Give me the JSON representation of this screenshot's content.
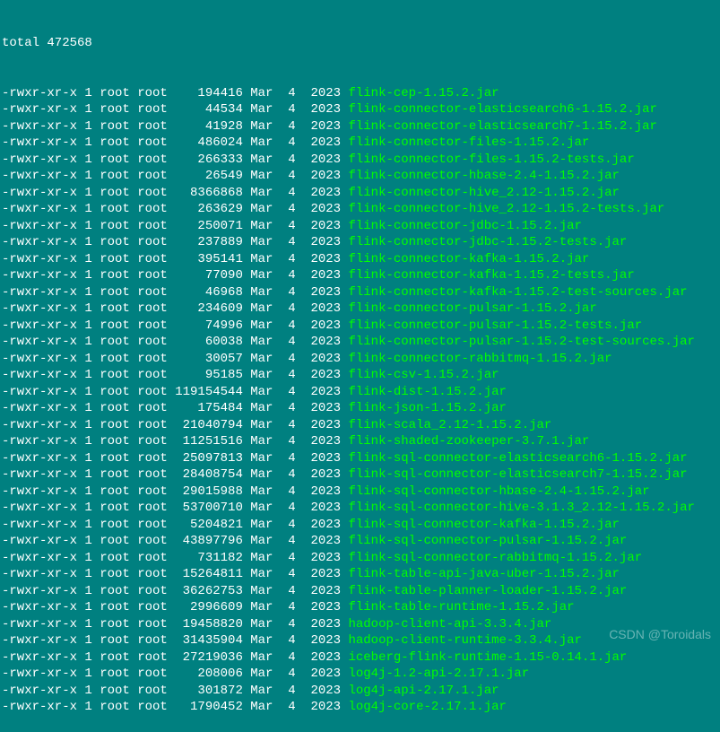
{
  "total": "total 472568",
  "watermark": "CSDN @Toroidals",
  "files": [
    {
      "perms": "-rwxr-xr-x",
      "links": "1",
      "owner": "root",
      "group": "root",
      "size": "194416",
      "month": "Mar",
      "day": "4",
      "year": "2023",
      "name": "flink-cep-1.15.2.jar"
    },
    {
      "perms": "-rwxr-xr-x",
      "links": "1",
      "owner": "root",
      "group": "root",
      "size": "44534",
      "month": "Mar",
      "day": "4",
      "year": "2023",
      "name": "flink-connector-elasticsearch6-1.15.2.jar"
    },
    {
      "perms": "-rwxr-xr-x",
      "links": "1",
      "owner": "root",
      "group": "root",
      "size": "41928",
      "month": "Mar",
      "day": "4",
      "year": "2023",
      "name": "flink-connector-elasticsearch7-1.15.2.jar"
    },
    {
      "perms": "-rwxr-xr-x",
      "links": "1",
      "owner": "root",
      "group": "root",
      "size": "486024",
      "month": "Mar",
      "day": "4",
      "year": "2023",
      "name": "flink-connector-files-1.15.2.jar"
    },
    {
      "perms": "-rwxr-xr-x",
      "links": "1",
      "owner": "root",
      "group": "root",
      "size": "266333",
      "month": "Mar",
      "day": "4",
      "year": "2023",
      "name": "flink-connector-files-1.15.2-tests.jar"
    },
    {
      "perms": "-rwxr-xr-x",
      "links": "1",
      "owner": "root",
      "group": "root",
      "size": "26549",
      "month": "Mar",
      "day": "4",
      "year": "2023",
      "name": "flink-connector-hbase-2.4-1.15.2.jar"
    },
    {
      "perms": "-rwxr-xr-x",
      "links": "1",
      "owner": "root",
      "group": "root",
      "size": "8366868",
      "month": "Mar",
      "day": "4",
      "year": "2023",
      "name": "flink-connector-hive_2.12-1.15.2.jar"
    },
    {
      "perms": "-rwxr-xr-x",
      "links": "1",
      "owner": "root",
      "group": "root",
      "size": "263629",
      "month": "Mar",
      "day": "4",
      "year": "2023",
      "name": "flink-connector-hive_2.12-1.15.2-tests.jar"
    },
    {
      "perms": "-rwxr-xr-x",
      "links": "1",
      "owner": "root",
      "group": "root",
      "size": "250071",
      "month": "Mar",
      "day": "4",
      "year": "2023",
      "name": "flink-connector-jdbc-1.15.2.jar"
    },
    {
      "perms": "-rwxr-xr-x",
      "links": "1",
      "owner": "root",
      "group": "root",
      "size": "237889",
      "month": "Mar",
      "day": "4",
      "year": "2023",
      "name": "flink-connector-jdbc-1.15.2-tests.jar"
    },
    {
      "perms": "-rwxr-xr-x",
      "links": "1",
      "owner": "root",
      "group": "root",
      "size": "395141",
      "month": "Mar",
      "day": "4",
      "year": "2023",
      "name": "flink-connector-kafka-1.15.2.jar"
    },
    {
      "perms": "-rwxr-xr-x",
      "links": "1",
      "owner": "root",
      "group": "root",
      "size": "77090",
      "month": "Mar",
      "day": "4",
      "year": "2023",
      "name": "flink-connector-kafka-1.15.2-tests.jar"
    },
    {
      "perms": "-rwxr-xr-x",
      "links": "1",
      "owner": "root",
      "group": "root",
      "size": "46968",
      "month": "Mar",
      "day": "4",
      "year": "2023",
      "name": "flink-connector-kafka-1.15.2-test-sources.jar"
    },
    {
      "perms": "-rwxr-xr-x",
      "links": "1",
      "owner": "root",
      "group": "root",
      "size": "234609",
      "month": "Mar",
      "day": "4",
      "year": "2023",
      "name": "flink-connector-pulsar-1.15.2.jar"
    },
    {
      "perms": "-rwxr-xr-x",
      "links": "1",
      "owner": "root",
      "group": "root",
      "size": "74996",
      "month": "Mar",
      "day": "4",
      "year": "2023",
      "name": "flink-connector-pulsar-1.15.2-tests.jar"
    },
    {
      "perms": "-rwxr-xr-x",
      "links": "1",
      "owner": "root",
      "group": "root",
      "size": "60038",
      "month": "Mar",
      "day": "4",
      "year": "2023",
      "name": "flink-connector-pulsar-1.15.2-test-sources.jar"
    },
    {
      "perms": "-rwxr-xr-x",
      "links": "1",
      "owner": "root",
      "group": "root",
      "size": "30057",
      "month": "Mar",
      "day": "4",
      "year": "2023",
      "name": "flink-connector-rabbitmq-1.15.2.jar"
    },
    {
      "perms": "-rwxr-xr-x",
      "links": "1",
      "owner": "root",
      "group": "root",
      "size": "95185",
      "month": "Mar",
      "day": "4",
      "year": "2023",
      "name": "flink-csv-1.15.2.jar"
    },
    {
      "perms": "-rwxr-xr-x",
      "links": "1",
      "owner": "root",
      "group": "root",
      "size": "119154544",
      "month": "Mar",
      "day": "4",
      "year": "2023",
      "name": "flink-dist-1.15.2.jar"
    },
    {
      "perms": "-rwxr-xr-x",
      "links": "1",
      "owner": "root",
      "group": "root",
      "size": "175484",
      "month": "Mar",
      "day": "4",
      "year": "2023",
      "name": "flink-json-1.15.2.jar"
    },
    {
      "perms": "-rwxr-xr-x",
      "links": "1",
      "owner": "root",
      "group": "root",
      "size": "21040794",
      "month": "Mar",
      "day": "4",
      "year": "2023",
      "name": "flink-scala_2.12-1.15.2.jar"
    },
    {
      "perms": "-rwxr-xr-x",
      "links": "1",
      "owner": "root",
      "group": "root",
      "size": "11251516",
      "month": "Mar",
      "day": "4",
      "year": "2023",
      "name": "flink-shaded-zookeeper-3.7.1.jar"
    },
    {
      "perms": "-rwxr-xr-x",
      "links": "1",
      "owner": "root",
      "group": "root",
      "size": "25097813",
      "month": "Mar",
      "day": "4",
      "year": "2023",
      "name": "flink-sql-connector-elasticsearch6-1.15.2.jar"
    },
    {
      "perms": "-rwxr-xr-x",
      "links": "1",
      "owner": "root",
      "group": "root",
      "size": "28408754",
      "month": "Mar",
      "day": "4",
      "year": "2023",
      "name": "flink-sql-connector-elasticsearch7-1.15.2.jar"
    },
    {
      "perms": "-rwxr-xr-x",
      "links": "1",
      "owner": "root",
      "group": "root",
      "size": "29015988",
      "month": "Mar",
      "day": "4",
      "year": "2023",
      "name": "flink-sql-connector-hbase-2.4-1.15.2.jar"
    },
    {
      "perms": "-rwxr-xr-x",
      "links": "1",
      "owner": "root",
      "group": "root",
      "size": "53700710",
      "month": "Mar",
      "day": "4",
      "year": "2023",
      "name": "flink-sql-connector-hive-3.1.3_2.12-1.15.2.jar"
    },
    {
      "perms": "-rwxr-xr-x",
      "links": "1",
      "owner": "root",
      "group": "root",
      "size": "5204821",
      "month": "Mar",
      "day": "4",
      "year": "2023",
      "name": "flink-sql-connector-kafka-1.15.2.jar"
    },
    {
      "perms": "-rwxr-xr-x",
      "links": "1",
      "owner": "root",
      "group": "root",
      "size": "43897796",
      "month": "Mar",
      "day": "4",
      "year": "2023",
      "name": "flink-sql-connector-pulsar-1.15.2.jar"
    },
    {
      "perms": "-rwxr-xr-x",
      "links": "1",
      "owner": "root",
      "group": "root",
      "size": "731182",
      "month": "Mar",
      "day": "4",
      "year": "2023",
      "name": "flink-sql-connector-rabbitmq-1.15.2.jar"
    },
    {
      "perms": "-rwxr-xr-x",
      "links": "1",
      "owner": "root",
      "group": "root",
      "size": "15264811",
      "month": "Mar",
      "day": "4",
      "year": "2023",
      "name": "flink-table-api-java-uber-1.15.2.jar"
    },
    {
      "perms": "-rwxr-xr-x",
      "links": "1",
      "owner": "root",
      "group": "root",
      "size": "36262753",
      "month": "Mar",
      "day": "4",
      "year": "2023",
      "name": "flink-table-planner-loader-1.15.2.jar"
    },
    {
      "perms": "-rwxr-xr-x",
      "links": "1",
      "owner": "root",
      "group": "root",
      "size": "2996609",
      "month": "Mar",
      "day": "4",
      "year": "2023",
      "name": "flink-table-runtime-1.15.2.jar"
    },
    {
      "perms": "-rwxr-xr-x",
      "links": "1",
      "owner": "root",
      "group": "root",
      "size": "19458820",
      "month": "Mar",
      "day": "4",
      "year": "2023",
      "name": "hadoop-client-api-3.3.4.jar"
    },
    {
      "perms": "-rwxr-xr-x",
      "links": "1",
      "owner": "root",
      "group": "root",
      "size": "31435904",
      "month": "Mar",
      "day": "4",
      "year": "2023",
      "name": "hadoop-client-runtime-3.3.4.jar"
    },
    {
      "perms": "-rwxr-xr-x",
      "links": "1",
      "owner": "root",
      "group": "root",
      "size": "27219036",
      "month": "Mar",
      "day": "4",
      "year": "2023",
      "name": "iceberg-flink-runtime-1.15-0.14.1.jar"
    },
    {
      "perms": "-rwxr-xr-x",
      "links": "1",
      "owner": "root",
      "group": "root",
      "size": "208006",
      "month": "Mar",
      "day": "4",
      "year": "2023",
      "name": "log4j-1.2-api-2.17.1.jar"
    },
    {
      "perms": "-rwxr-xr-x",
      "links": "1",
      "owner": "root",
      "group": "root",
      "size": "301872",
      "month": "Mar",
      "day": "4",
      "year": "2023",
      "name": "log4j-api-2.17.1.jar"
    },
    {
      "perms": "-rwxr-xr-x",
      "links": "1",
      "owner": "root",
      "group": "root",
      "size": "1790452",
      "month": "Mar",
      "day": "4",
      "year": "2023",
      "name": "log4j-core-2.17.1.jar"
    }
  ]
}
